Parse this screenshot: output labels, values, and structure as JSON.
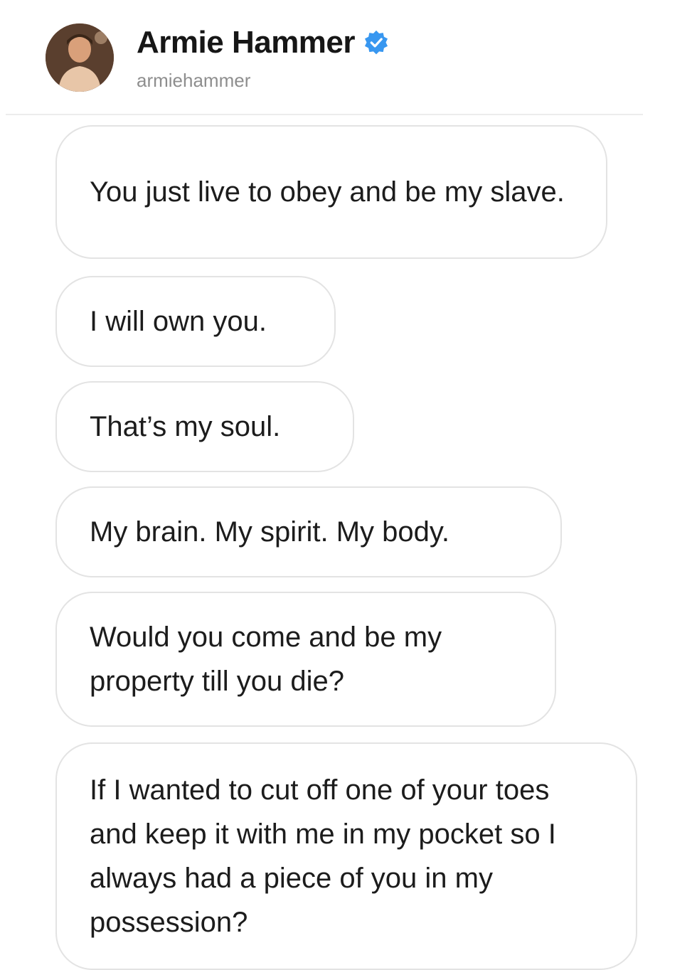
{
  "profile": {
    "name": "Armie Hammer",
    "username": "armiehammer",
    "verified_icon": "verified-badge-icon",
    "verified_color": "#3897f0"
  },
  "messages": [
    {
      "text": "You just live to obey and be my slave."
    },
    {
      "text": "I will own you."
    },
    {
      "text": "That’s my soul."
    },
    {
      "text": "My brain. My spirit. My body."
    },
    {
      "text": "Would you come and be my property till you die?"
    },
    {
      "text": "If I wanted to cut off one of your toes and keep it with me in my pocket so I always had a piece of you in my possession?"
    }
  ]
}
